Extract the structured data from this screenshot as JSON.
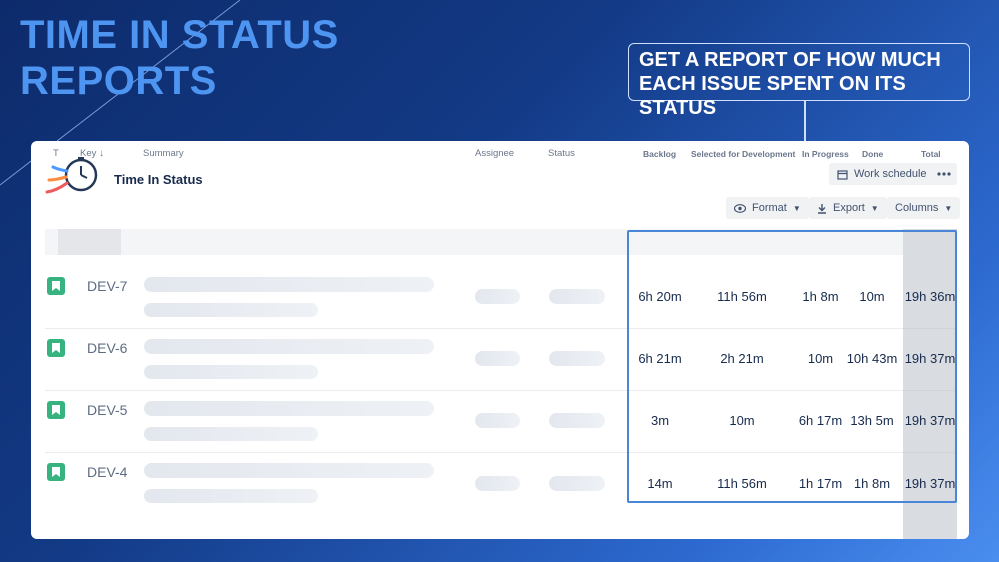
{
  "hero": {
    "line1": "TIME IN STATUS",
    "line2": "REPORTS"
  },
  "callout": {
    "text": "GET A REPORT OF HOW MUCH EACH ISSUE SPENT ON ITS STATUS"
  },
  "app": {
    "title": "Time In Status",
    "logo_icon": "clock-speed-icon"
  },
  "toolbar": {
    "work_schedule": "Work schedule",
    "format": "Format",
    "export": "Export",
    "columns": "Columns"
  },
  "table": {
    "headers": {
      "type": "T",
      "key": "Key",
      "summary": "Summary",
      "assignee": "Assignee",
      "status": "Status",
      "backlog": "Backlog",
      "selected": "Selected for Development",
      "in_progress": "In Progress",
      "done": "Done",
      "total": "Total"
    },
    "rows": [
      {
        "key": "DEV-7",
        "backlog": "6h 20m",
        "selected": "11h 56m",
        "in_progress": "1h 8m",
        "done": "10m",
        "total": "19h 36m"
      },
      {
        "key": "DEV-6",
        "backlog": "6h 21m",
        "selected": "2h 21m",
        "in_progress": "10m",
        "done": "10h 43m",
        "total": "19h 37m"
      },
      {
        "key": "DEV-5",
        "backlog": "3m",
        "selected": "10m",
        "in_progress": "6h 17m",
        "done": "13h 5m",
        "total": "19h 37m"
      },
      {
        "key": "DEV-4",
        "backlog": "14m",
        "selected": "11h 56m",
        "in_progress": "1h 17m",
        "done": "1h 8m",
        "total": "19h 37m"
      }
    ]
  },
  "colors": {
    "hero_text": "#4e95f2",
    "issue_icon": "#36b37e",
    "highlight": "#4a86d8"
  }
}
